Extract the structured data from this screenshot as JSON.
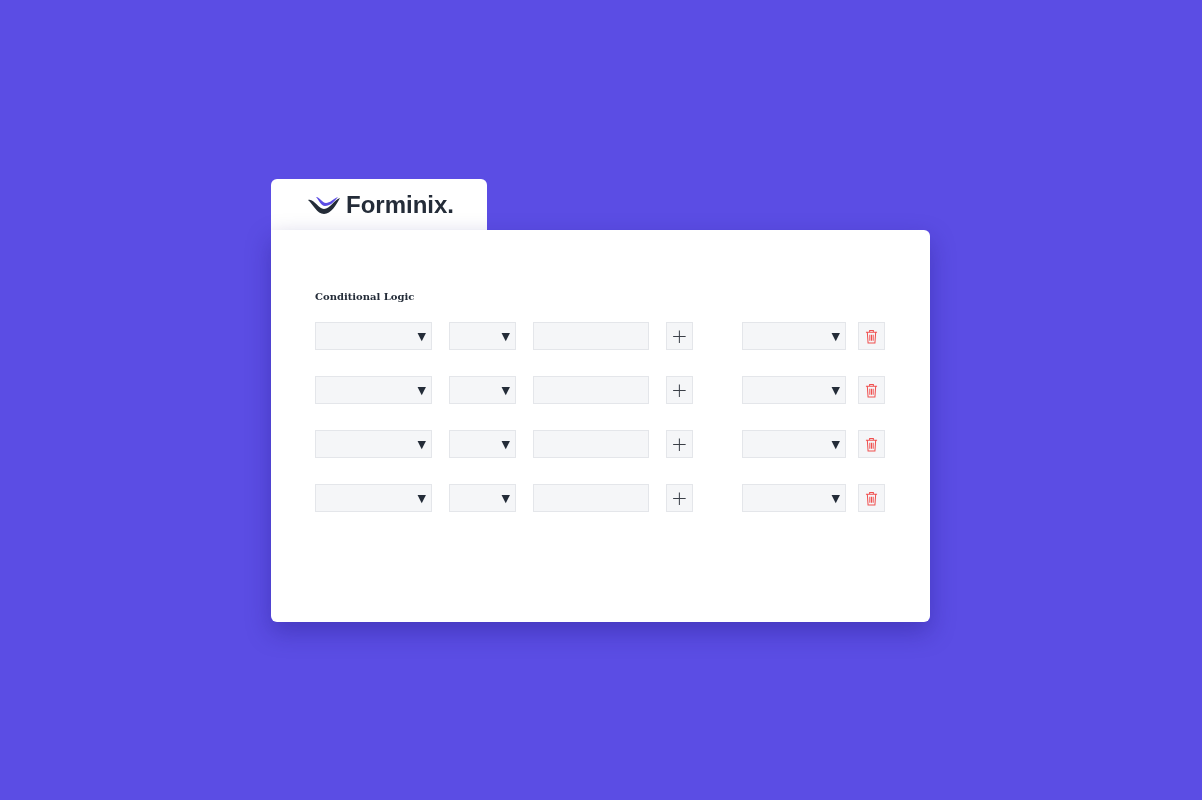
{
  "brand": {
    "name": "Forminix."
  },
  "section": {
    "title": "Conditional Logic"
  },
  "rows": [
    {
      "kind": "condition",
      "field_caret": "▼",
      "operator_caret": "▼",
      "add": "+",
      "action_caret": "▼"
    },
    {
      "kind": "condition",
      "field_caret": "▼",
      "operator_caret": "▼",
      "add": "+",
      "action_caret": "▼"
    },
    {
      "kind": "condition",
      "field_caret": "▼",
      "operator_caret": "▼",
      "add": "+",
      "action_caret": "▼"
    },
    {
      "kind": "condition",
      "field_caret": "▼",
      "operator_caret": "▼",
      "add": "+",
      "action_caret": "▼"
    }
  ]
}
